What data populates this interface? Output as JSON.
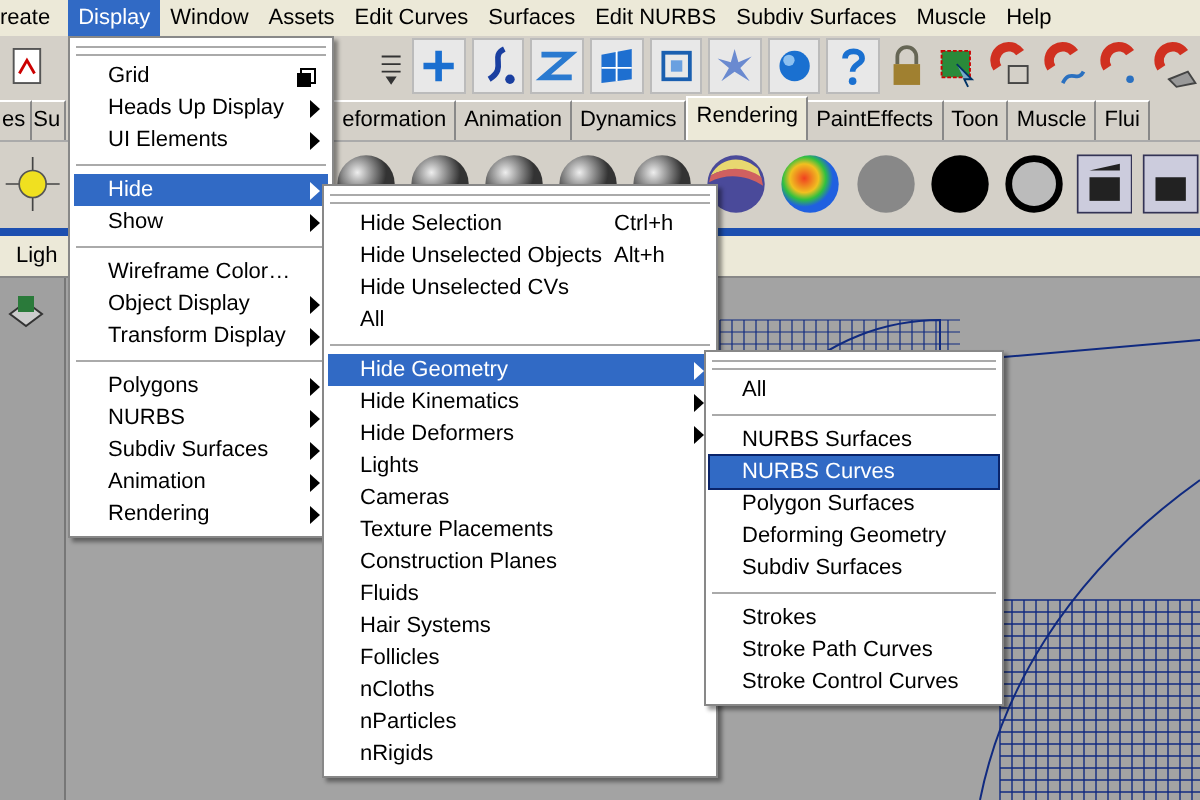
{
  "menubar": [
    {
      "label": "reate",
      "selected": false
    },
    {
      "label": "Display",
      "selected": true
    },
    {
      "label": "Window",
      "selected": false
    },
    {
      "label": "Assets",
      "selected": false
    },
    {
      "label": "Edit Curves",
      "selected": false
    },
    {
      "label": "Surfaces",
      "selected": false
    },
    {
      "label": "Edit NURBS",
      "selected": false
    },
    {
      "label": "Subdiv Surfaces",
      "selected": false
    },
    {
      "label": "Muscle",
      "selected": false
    },
    {
      "label": "Help",
      "selected": false
    }
  ],
  "shelf_tabs_left": [
    {
      "label": "es",
      "selected": false
    },
    {
      "label": "Su",
      "selected": false
    }
  ],
  "shelf_tabs": [
    {
      "label": "eformation",
      "selected": false
    },
    {
      "label": "Animation",
      "selected": false
    },
    {
      "label": "Dynamics",
      "selected": false
    },
    {
      "label": "Rendering",
      "selected": true
    },
    {
      "label": "PaintEffects",
      "selected": false
    },
    {
      "label": "Toon",
      "selected": false
    },
    {
      "label": "Muscle",
      "selected": false
    },
    {
      "label": "Flui",
      "selected": false
    }
  ],
  "panel_menu": [
    "Ligh"
  ],
  "menus": [
    {
      "items": [
        {
          "kind": "item",
          "label": "Grid",
          "option_box": true,
          "submenu": false,
          "selected": false
        },
        {
          "kind": "item",
          "label": "Heads Up Display",
          "submenu": true,
          "selected": false
        },
        {
          "kind": "item",
          "label": "UI Elements",
          "submenu": true,
          "selected": false
        },
        {
          "kind": "separator"
        },
        {
          "kind": "item",
          "label": "Hide",
          "submenu": true,
          "selected": true
        },
        {
          "kind": "item",
          "label": "Show",
          "submenu": true,
          "selected": false
        },
        {
          "kind": "separator"
        },
        {
          "kind": "item",
          "label": "Wireframe Color…",
          "submenu": false,
          "selected": false
        },
        {
          "kind": "item",
          "label": "Object Display",
          "submenu": true,
          "selected": false
        },
        {
          "kind": "item",
          "label": "Transform Display",
          "submenu": true,
          "selected": false
        },
        {
          "kind": "separator"
        },
        {
          "kind": "item",
          "label": "Polygons",
          "submenu": true,
          "selected": false
        },
        {
          "kind": "item",
          "label": "NURBS",
          "submenu": true,
          "selected": false
        },
        {
          "kind": "item",
          "label": "Subdiv Surfaces",
          "submenu": true,
          "selected": false
        },
        {
          "kind": "item",
          "label": "Animation",
          "submenu": true,
          "selected": false
        },
        {
          "kind": "item",
          "label": "Rendering",
          "submenu": true,
          "selected": false
        }
      ]
    },
    {
      "items": [
        {
          "kind": "item",
          "label": "Hide Selection",
          "shortcut": "Ctrl+h",
          "submenu": false,
          "selected": false
        },
        {
          "kind": "item",
          "label": "Hide Unselected Objects",
          "shortcut": "Alt+h",
          "submenu": false,
          "selected": false
        },
        {
          "kind": "item",
          "label": "Hide Unselected CVs",
          "submenu": false,
          "selected": false
        },
        {
          "kind": "item",
          "label": "All",
          "submenu": false,
          "selected": false
        },
        {
          "kind": "separator"
        },
        {
          "kind": "item",
          "label": "Hide Geometry",
          "submenu": true,
          "selected": true
        },
        {
          "kind": "item",
          "label": "Hide Kinematics",
          "submenu": true,
          "selected": false
        },
        {
          "kind": "item",
          "label": "Hide Deformers",
          "submenu": true,
          "selected": false
        },
        {
          "kind": "item",
          "label": "Lights",
          "submenu": false,
          "selected": false
        },
        {
          "kind": "item",
          "label": "Cameras",
          "submenu": false,
          "selected": false
        },
        {
          "kind": "item",
          "label": "Texture Placements",
          "submenu": false,
          "selected": false
        },
        {
          "kind": "item",
          "label": "Construction Planes",
          "submenu": false,
          "selected": false
        },
        {
          "kind": "item",
          "label": "Fluids",
          "submenu": false,
          "selected": false
        },
        {
          "kind": "item",
          "label": "Hair Systems",
          "submenu": false,
          "selected": false
        },
        {
          "kind": "item",
          "label": "Follicles",
          "submenu": false,
          "selected": false
        },
        {
          "kind": "item",
          "label": "nCloths",
          "submenu": false,
          "selected": false
        },
        {
          "kind": "item",
          "label": "nParticles",
          "submenu": false,
          "selected": false
        },
        {
          "kind": "item",
          "label": "nRigids",
          "submenu": false,
          "selected": false
        }
      ]
    },
    {
      "items": [
        {
          "kind": "item",
          "label": "All",
          "submenu": false,
          "selected": false
        },
        {
          "kind": "separator"
        },
        {
          "kind": "item",
          "label": "NURBS Surfaces",
          "submenu": false,
          "selected": false
        },
        {
          "kind": "item",
          "label": "NURBS Curves",
          "submenu": false,
          "selected": true
        },
        {
          "kind": "item",
          "label": "Polygon Surfaces",
          "submenu": false,
          "selected": false
        },
        {
          "kind": "item",
          "label": "Deforming Geometry",
          "submenu": false,
          "selected": false
        },
        {
          "kind": "item",
          "label": "Subdiv Surfaces",
          "submenu": false,
          "selected": false
        },
        {
          "kind": "separator"
        },
        {
          "kind": "item",
          "label": "Strokes",
          "submenu": false,
          "selected": false
        },
        {
          "kind": "item",
          "label": "Stroke Path Curves",
          "submenu": false,
          "selected": false
        },
        {
          "kind": "item",
          "label": "Stroke Control Curves",
          "submenu": false,
          "selected": false
        }
      ]
    }
  ]
}
